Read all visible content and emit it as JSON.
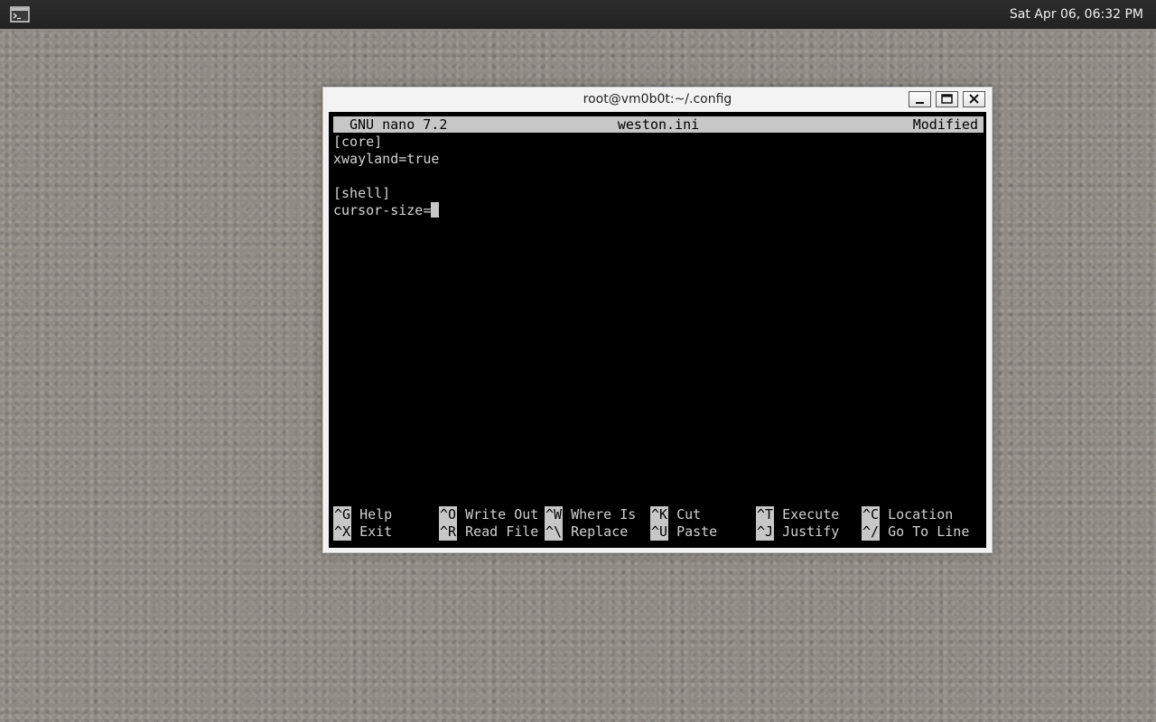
{
  "panel": {
    "clock": "Sat Apr 06, 06:32 PM",
    "launcher_icon": "terminal-icon"
  },
  "window": {
    "title": "root@vm0b0t:~/.config",
    "buttons": {
      "minimize_icon": "minimize-icon",
      "maximize_icon": "maximize-icon",
      "close_icon": "close-icon"
    }
  },
  "nano": {
    "version": "GNU nano 7.2",
    "filename": "weston.ini",
    "status": "Modified",
    "lines": [
      "[core]",
      "xwayland=true",
      "",
      "[shell]",
      "cursor-size="
    ],
    "shortcuts_row1": [
      {
        "key": "^G",
        "label": "Help"
      },
      {
        "key": "^O",
        "label": "Write Out"
      },
      {
        "key": "^W",
        "label": "Where Is"
      },
      {
        "key": "^K",
        "label": "Cut"
      },
      {
        "key": "^T",
        "label": "Execute"
      },
      {
        "key": "^C",
        "label": "Location"
      }
    ],
    "shortcuts_row2": [
      {
        "key": "^X",
        "label": "Exit"
      },
      {
        "key": "^R",
        "label": "Read File"
      },
      {
        "key": "^\\",
        "label": "Replace"
      },
      {
        "key": "^U",
        "label": "Paste"
      },
      {
        "key": "^J",
        "label": "Justify"
      },
      {
        "key": "^/",
        "label": "Go To Line"
      }
    ]
  },
  "colors": {
    "terminal_bg": "#000000",
    "terminal_fg": "#d0d0d0",
    "header_bg": "#c7c7c7",
    "panel_bg": "#262626",
    "desktop_bg": "#8f8a84"
  }
}
